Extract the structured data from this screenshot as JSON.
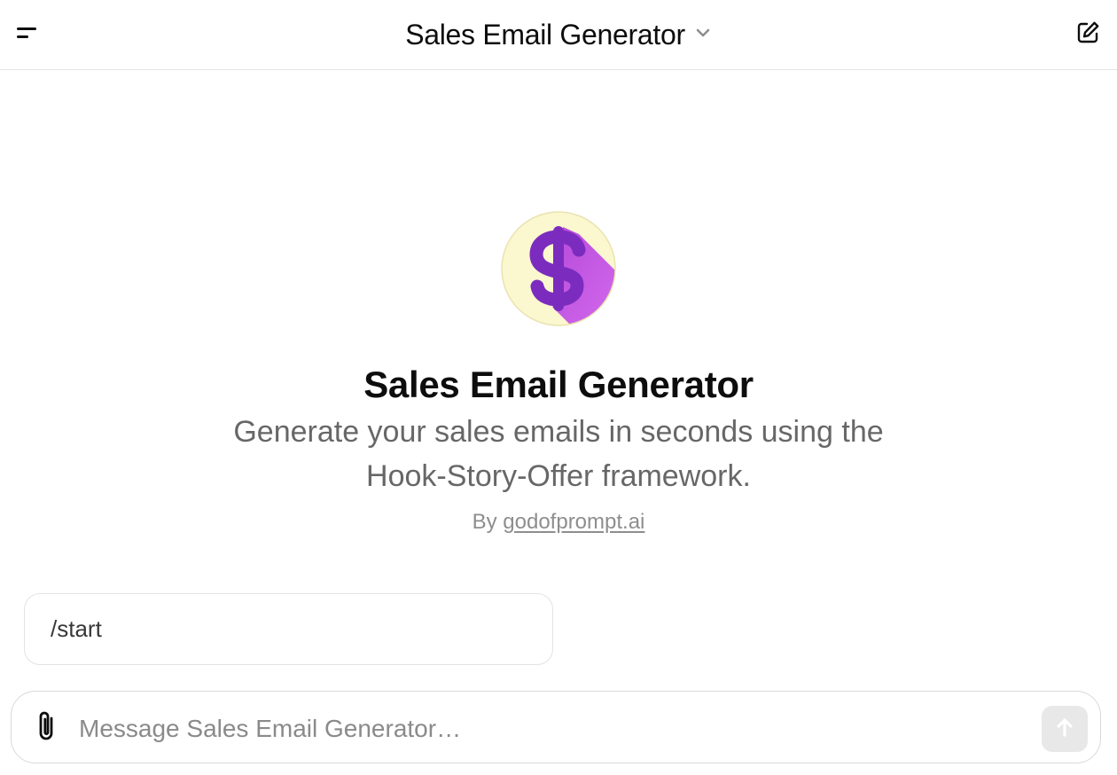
{
  "header": {
    "title": "Sales Email Generator",
    "menu_icon": "sidebar-menu-icon",
    "dropdown_icon": "chevron-down-icon",
    "new_chat_icon": "edit-icon"
  },
  "gpt": {
    "name": "Sales Email Generator",
    "description": "Generate your sales emails in seconds using the Hook-Story-Offer framework.",
    "by_prefix": "By",
    "author": "godofprompt.ai",
    "avatar_icon": "dollar-sign-icon",
    "avatar_bg": "#fbf7cf",
    "avatar_symbol_color": "#7b2cbf",
    "avatar_shadow_color": "#c855e0"
  },
  "starters": [
    {
      "label": "/start"
    }
  ],
  "composer": {
    "placeholder": "Message Sales Email Generator…",
    "attach_icon": "paperclip-icon",
    "send_icon": "arrow-up-icon"
  }
}
